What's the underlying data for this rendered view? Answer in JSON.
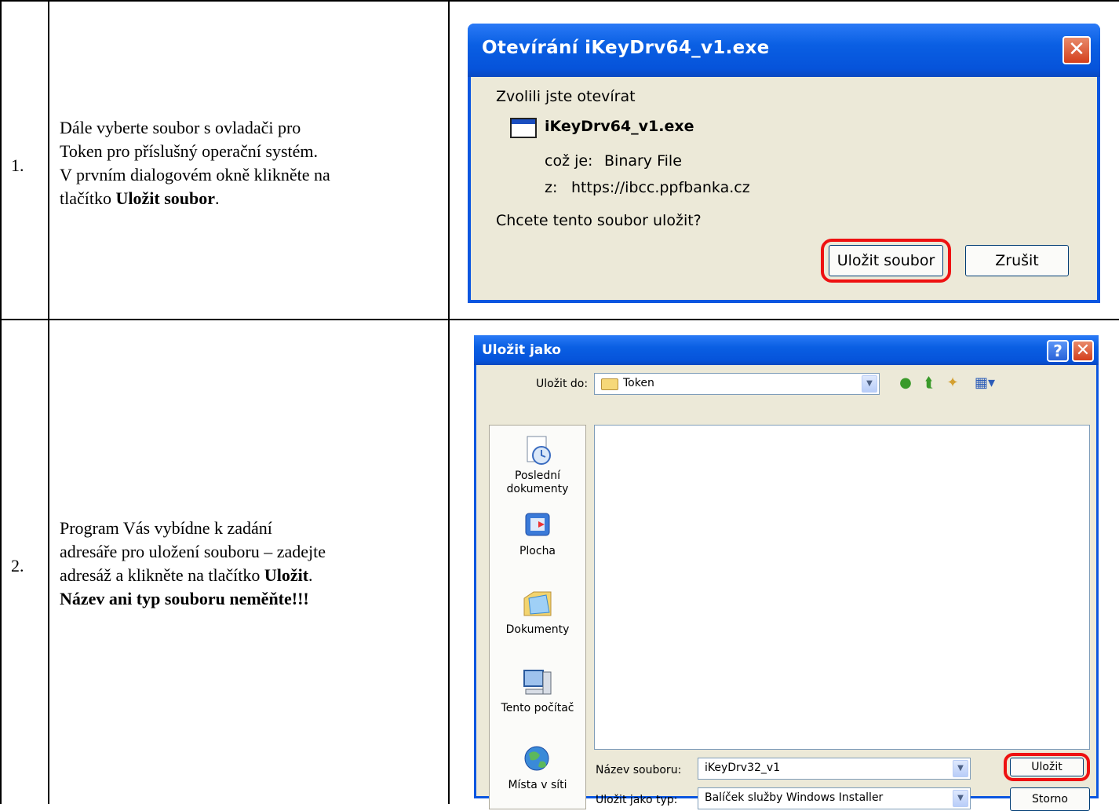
{
  "rows": [
    {
      "number": "1.",
      "desc_lines": [
        "Dále vyberte soubor s ovladači pro",
        "Token pro příslušný operační systém.",
        "V prvním dialogovém okně klikněte na"
      ],
      "desc_tail_prefix": "tlačítko ",
      "desc_tail_bold": "Uložit soubor",
      "desc_tail_suffix": "."
    },
    {
      "number": "2.",
      "desc_lines": [
        "Program Vás vybídne k zadání",
        "adresáře pro uložení souboru – zadejte"
      ],
      "desc_line3_prefix": "adresáž a klikněte na tlačítko ",
      "desc_line3_bold": "Uložit",
      "desc_line3_suffix": ".",
      "desc_line4_bold": "Název ani typ souboru neměňte!!!"
    }
  ],
  "dialog_open": {
    "title": "Otevírání iKeyDrv64_v1.exe",
    "intro": "Zvolili jste otevírat",
    "filename": "iKeyDrv64_v1.exe",
    "type_label": "což je:",
    "type_value": "Binary File",
    "from_label": "z:",
    "from_value": "https://ibcc.ppfbanka.cz",
    "question": "Chcete tento soubor uložit?",
    "save_label": "Uložit soubor",
    "cancel_label": "Zrušit",
    "close_glyph": "✕"
  },
  "dialog_save": {
    "title": "Uložit jako",
    "help_glyph": "?",
    "close_glyph": "✕",
    "save_in_label": "Uložit do:",
    "save_in_value": "Token",
    "places": [
      "Poslední dokumenty",
      "Plocha",
      "Dokumenty",
      "Tento počítač",
      "Místa v síti"
    ],
    "filename_label": "Název souboru:",
    "filename_value": "iKeyDrv32_v1",
    "filetype_label": "Uložit jako typ:",
    "filetype_value": "Balíček služby Windows Installer",
    "save_label": "Uložit",
    "cancel_label": "Storno",
    "highlight_color": "#e11111"
  }
}
